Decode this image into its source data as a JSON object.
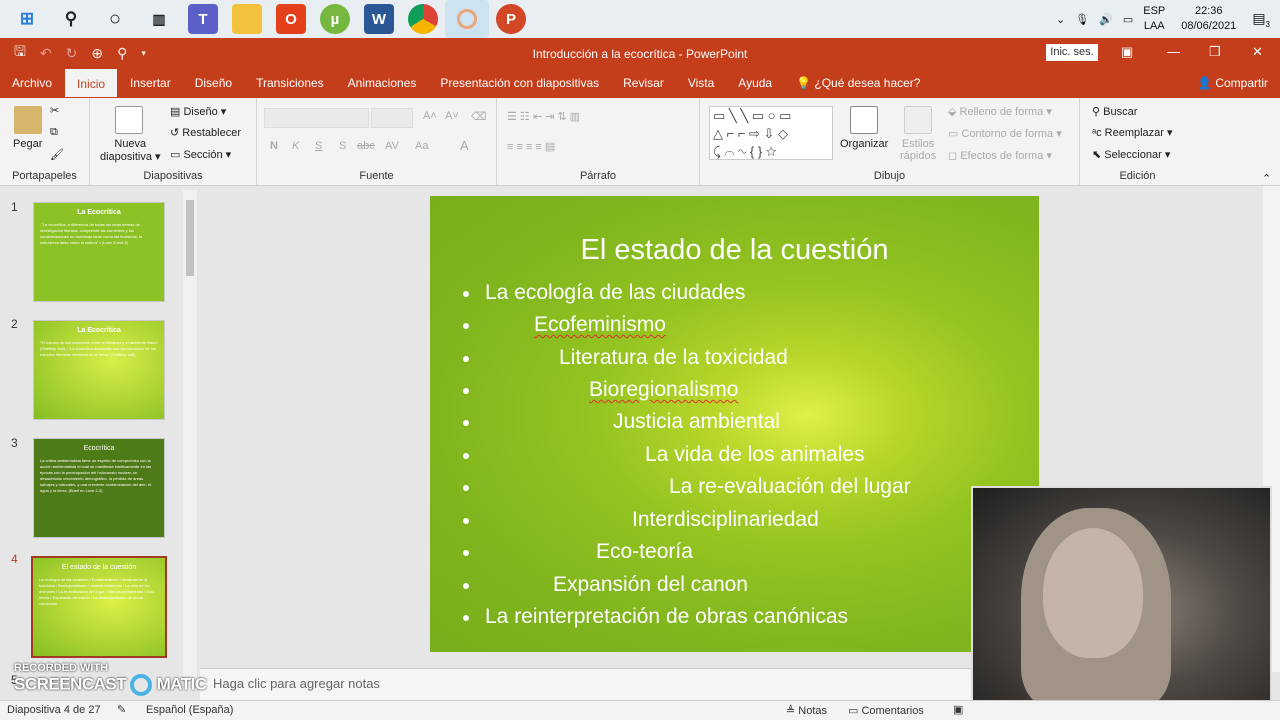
{
  "taskbar": {
    "icons": [
      "windows-start-icon",
      "search-icon",
      "cortana-icon",
      "task-view-icon",
      "teams-icon",
      "file-explorer-icon",
      "office-icon",
      "utorrent-icon",
      "word-icon",
      "chrome-icon",
      "app-icon",
      "powerpoint-icon"
    ],
    "tray": {
      "lang1": "ESP",
      "lang2": "LAA",
      "time": "22:36",
      "date": "08/06/2021",
      "notif_count": "3"
    }
  },
  "window": {
    "title": "Introducción a la ecocrítica  -  PowerPoint",
    "signin": "Inic. ses.",
    "share": "Compartir",
    "tell_me": "¿Qué desea hacer?"
  },
  "tabs": [
    "Archivo",
    "Inicio",
    "Insertar",
    "Diseño",
    "Transiciones",
    "Animaciones",
    "Presentación con diapositivas",
    "Revisar",
    "Vista",
    "Ayuda"
  ],
  "ribbon": {
    "portapapeles": {
      "label": "Portapapeles",
      "pegar": "Pegar"
    },
    "diapositivas": {
      "label": "Diapositivas",
      "nueva": "Nueva",
      "diapositiva": "diapositiva",
      "diseno": "Diseño",
      "restablecer": "Restablecer",
      "seccion": "Sección"
    },
    "fuente": {
      "label": "Fuente",
      "n": "N",
      "k": "K",
      "s": "S",
      "abc": "abc",
      "aa": "Aa"
    },
    "parrafo": {
      "label": "Párrafo"
    },
    "dibujo": {
      "label": "Dibujo",
      "organizar": "Organizar",
      "estilos": "Estilos",
      "rapidos": "rápidos",
      "relleno": "Relleno de forma",
      "contorno": "Contorno de forma",
      "efectos": "Efectos de forma"
    },
    "edicion": {
      "label": "Edición",
      "buscar": "Buscar",
      "reemplazar": "Reemplazar",
      "seleccionar": "Seleccionar"
    }
  },
  "thumbs": [
    {
      "num": "1",
      "title": "La Ecocrítica",
      "body": "-\"La ecocrítica, a diferencia de todas las otras formas de investigación literaria, comprende las corrientes y las consideraciones no humanas tanto como las humanas, la naturaleza tanto como la cultura\" • (Love 3 and 3)"
    },
    {
      "num": "2",
      "title": "La Ecocrítica",
      "body": "\"El estudio de las relaciones entre la literatura y el ambiente físico\" (Glotfelty xviii) • \"La ecocrítica desarrolla una aproximación de los estudios literarios centrada en la tierra\" (Glotfelty xviii)"
    },
    {
      "num": "3",
      "title": "Ecocrítica",
      "body": "La crítica ambientalista tiene un espíritu de compromiso con la acción ambientalista el cual se manifiesta intuitivamente en las épocas con la preocupación del holocausto nuclear, un desacertado crecimiento demográfico, la pérdida de áreas salvajes y naturales, y una creciente contaminación del aire, el agua y la tierra. (Buell en Love 2-3)"
    },
    {
      "num": "4",
      "title": "El estado de la cuestión",
      "body": "La ecología de las ciudades / Ecofeminismo / Literatura de la toxicidad / Bioregionalismo / Justicia ambiental / La vida de los animales / La re-evaluación del lugar / Interdisciplinariedad / Eco-teoría / Expansión del canon / La reinterpretación de obras canónicas"
    },
    {
      "num": "5"
    }
  ],
  "slide": {
    "title": "El estado de la cuestión",
    "bullets": [
      "La ecología de las ciudades",
      "Ecofeminismo",
      "Literatura de la toxicidad",
      "Bioregionalismo",
      "Justicia ambiental",
      "La vida de los animales",
      "La re-evaluación del lugar",
      "Interdisciplinariedad",
      "Eco-teoría",
      "Expansión del canon",
      "La reinterpretación de obras canónicas"
    ]
  },
  "notes_placeholder": "Haga clic para agregar notas",
  "status": {
    "slide_count": "Diapositiva 4 de 27",
    "language": "Español (España)",
    "notes": "Notas",
    "comments": "Comentarios"
  },
  "watermark": {
    "line1": "RECORDED WITH",
    "line2a": "SCREENCAST",
    "line2b": "MATIC"
  },
  "colors": {
    "accent": "#c43e1c",
    "slide_green": "#8cbf22",
    "slide_light": "#dff04a"
  }
}
